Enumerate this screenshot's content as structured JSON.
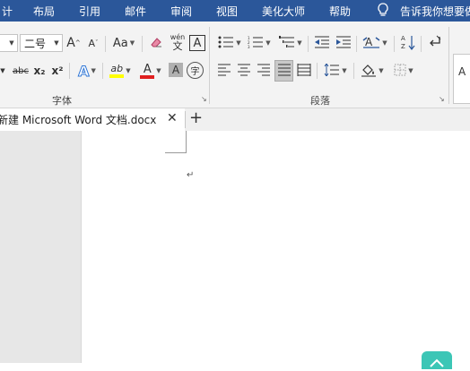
{
  "menu": {
    "items": [
      "计",
      "布局",
      "引用",
      "邮件",
      "审阅",
      "视图",
      "美化大师",
      "帮助"
    ],
    "tell_me": "告诉我你想要做"
  },
  "ribbon": {
    "font_name_fragment": "",
    "font_size": "二号",
    "grow_font": "A",
    "shrink_font": "A",
    "change_case": "Aa",
    "phonetic_top": "wén",
    "phonetic_bottom": "文",
    "char_border": "A",
    "strikethrough": "abc",
    "subscript": "x₂",
    "superscript": "x²",
    "text_effects": "A",
    "highlight": "ab",
    "font_color": "A",
    "char_shading": "A",
    "enclose_char": "字",
    "sort": "A↓",
    "show_marks": "↵",
    "groups": {
      "font": "字体",
      "paragraph": "段落"
    },
    "style_preview": "A"
  },
  "tabs": {
    "doc_title": "新建 Microsoft Word 文档.docx",
    "close": "✕",
    "new_tab": "+"
  },
  "document": {
    "paragraph_mark": "↵"
  },
  "colors": {
    "menubar_bg": "#2b579a",
    "highlight_yellow": "#ffff00",
    "font_color_red": "#e02020",
    "text_effects_blue": "#2e75d6",
    "accent_teal": "#3cc6b6"
  }
}
